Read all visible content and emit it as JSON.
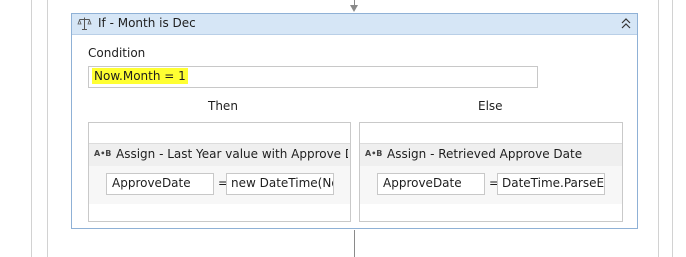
{
  "if_activity": {
    "title": "If - Month is Dec",
    "condition_label": "Condition",
    "condition_value": "Now.Month = 1",
    "then_label": "Then",
    "else_label": "Else"
  },
  "then_branch": {
    "assign_icon_text": "A•B",
    "assign_title": "Assign - Last Year value with Approve D",
    "to_value": "ApproveDate",
    "equals": "=",
    "value": "new DateTime(Now"
  },
  "else_branch": {
    "assign_icon_text": "A•B",
    "assign_title": "Assign - Retrieved Approve Date",
    "to_value": "ApproveDate",
    "equals": "=",
    "value": "DateTime.ParseExa"
  },
  "colors": {
    "header_bg": "#d6e6f6",
    "highlight": "#ffff32"
  },
  "icons": {
    "if_icon": "balance-scale-icon",
    "collapse_icon": "double-chevron-up-icon",
    "assign_icon": "assign-icon"
  }
}
